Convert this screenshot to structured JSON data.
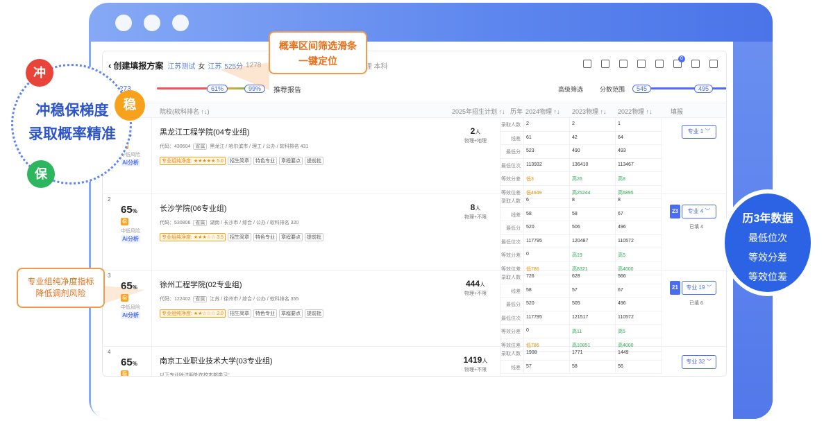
{
  "header": {
    "back": "‹",
    "title": "创建填报方案",
    "province_test": "江苏测试",
    "gender": "女",
    "province": "江苏",
    "score": "525分",
    "rank_partial": "1278",
    "subjects_partial": "化学/生物/地理 本科"
  },
  "filters": {
    "count": "273",
    "prob_low": "61%",
    "prob_high": "99%",
    "report": "推荐报告",
    "advanced": "高级筛选",
    "score_range": "分数范围",
    "score_low": "545",
    "score_high": "495"
  },
  "columns": {
    "school": "院校(软科排名 ↑↓)",
    "plan": "2025年招生计划 ↑↓",
    "history": "历年",
    "y2024": "2024物理 ↑↓",
    "y2023": "2023物理 ↑↓",
    "y2022": "2022物理 ↑↓",
    "fill": "填报"
  },
  "hist_labels": [
    "录取人数",
    "线差",
    "最低分",
    "最低位次",
    "等效分差",
    "等效位差"
  ],
  "rows": [
    {
      "rank": "",
      "prob": "9",
      "risk": "中低风险",
      "ai": "Ai分析",
      "school": "黑龙江工程学院(04专业组)",
      "code": "代码：430604",
      "type": "省属",
      "loc": "黑龙江 / 哈尔滨市 / 理工 / 公办 / 软科排名 431",
      "purity": "专业组纯净度: ★★★★★ 5.0",
      "tags": [
        "招生简章",
        "特色专业",
        "章程要点",
        "提前批"
      ],
      "plan": "2",
      "plan_unit": "人",
      "plan_sub": "物理+地理",
      "hist": [
        [
          "2",
          "2",
          "1"
        ],
        [
          "61",
          "42",
          "64"
        ],
        [
          "523",
          "490",
          "493"
        ],
        [
          "113932",
          "136410",
          "113467"
        ],
        [
          "低3",
          "高26",
          "高8"
        ],
        [
          "低4649",
          "高25244",
          "高6895"
        ]
      ],
      "major_btn": "专业 1 ﹀",
      "chip": "",
      "filled": ""
    },
    {
      "rank": "2",
      "prob": "65",
      "risk": "中低风险",
      "ai": "Ai分析",
      "school": "长沙学院(06专业组)",
      "code": "代码：530806",
      "type": "省属",
      "loc": "湖南 / 长沙市 / 综合 / 公办 / 软科排名 320",
      "purity": "专业组纯净度: ★★★☆☆ 3.5",
      "tags": [
        "招生简章",
        "特色专业",
        "章程要点",
        "提前批"
      ],
      "plan": "8",
      "plan_unit": "人",
      "plan_sub": "物理+不限",
      "hist": [
        [
          "6",
          "8",
          "8"
        ],
        [
          "58",
          "58",
          "67"
        ],
        [
          "520",
          "506",
          "496"
        ],
        [
          "117795",
          "120487",
          "110572"
        ],
        [
          "0",
          "高19",
          "高5"
        ],
        [
          "低786",
          "高8321",
          "高4000"
        ]
      ],
      "major_btn": "专业 4 ﹀",
      "chip": "23",
      "filled": "已填 4"
    },
    {
      "rank": "3",
      "prob": "65",
      "risk": "中低风险",
      "ai": "Ai分析",
      "school": "徐州工程学院(02专业组)",
      "code": "代码：122402",
      "type": "省属",
      "loc": "江苏 / 徐州市 / 综合 / 公办 / 软科排名 355",
      "purity": "专业组纯净度: ★★☆☆☆ 2.0",
      "tags": [
        "招生简章",
        "特色专业",
        "章程要点",
        "提前批"
      ],
      "plan": "444",
      "plan_unit": "人",
      "plan_sub": "物理+不限",
      "hist": [
        [
          "726",
          "628",
          "566"
        ],
        [
          "58",
          "57",
          "67"
        ],
        [
          "520",
          "505",
          "496"
        ],
        [
          "117795",
          "121517",
          "110572"
        ],
        [
          "0",
          "高11",
          "高5"
        ],
        [
          "低786",
          "高10851",
          "高4000"
        ]
      ],
      "major_btn": "专业 19 ﹀",
      "chip": "21",
      "filled": "已填 6"
    },
    {
      "rank": "4",
      "prob": "65",
      "risk": "",
      "ai": "",
      "school": "南京工业职业技术大学(03专业组)",
      "code": "以下专业除注明外在校本部学习：",
      "type": "",
      "loc": "",
      "purity": "",
      "tags": [],
      "plan": "1419",
      "plan_unit": "人",
      "plan_sub": "物理+不限",
      "hist": [
        [
          "1908",
          "1771",
          "1449"
        ],
        [
          "57",
          "58",
          "56"
        ]
      ],
      "major_btn": "专业 32 ﹀",
      "chip": "",
      "filled": ""
    }
  ],
  "callouts": {
    "top_line1": "概率区间筛选滑条",
    "top_line2": "一键定位",
    "left_line1": "专业组纯净度指标",
    "left_line2": "降低调剂风险",
    "circle_line1": "冲稳保梯度",
    "circle_line2": "录取概率精准",
    "chong": "冲",
    "wen": "稳",
    "bao": "保",
    "right_title": "历3年数据",
    "right_l1": "最低位次",
    "right_l2": "等效分差",
    "right_l3": "等效位差"
  },
  "colors": {
    "accent": "#4a6cf7",
    "orange": "#f39a4a",
    "red": "#e8443a",
    "green": "#2eb560"
  }
}
